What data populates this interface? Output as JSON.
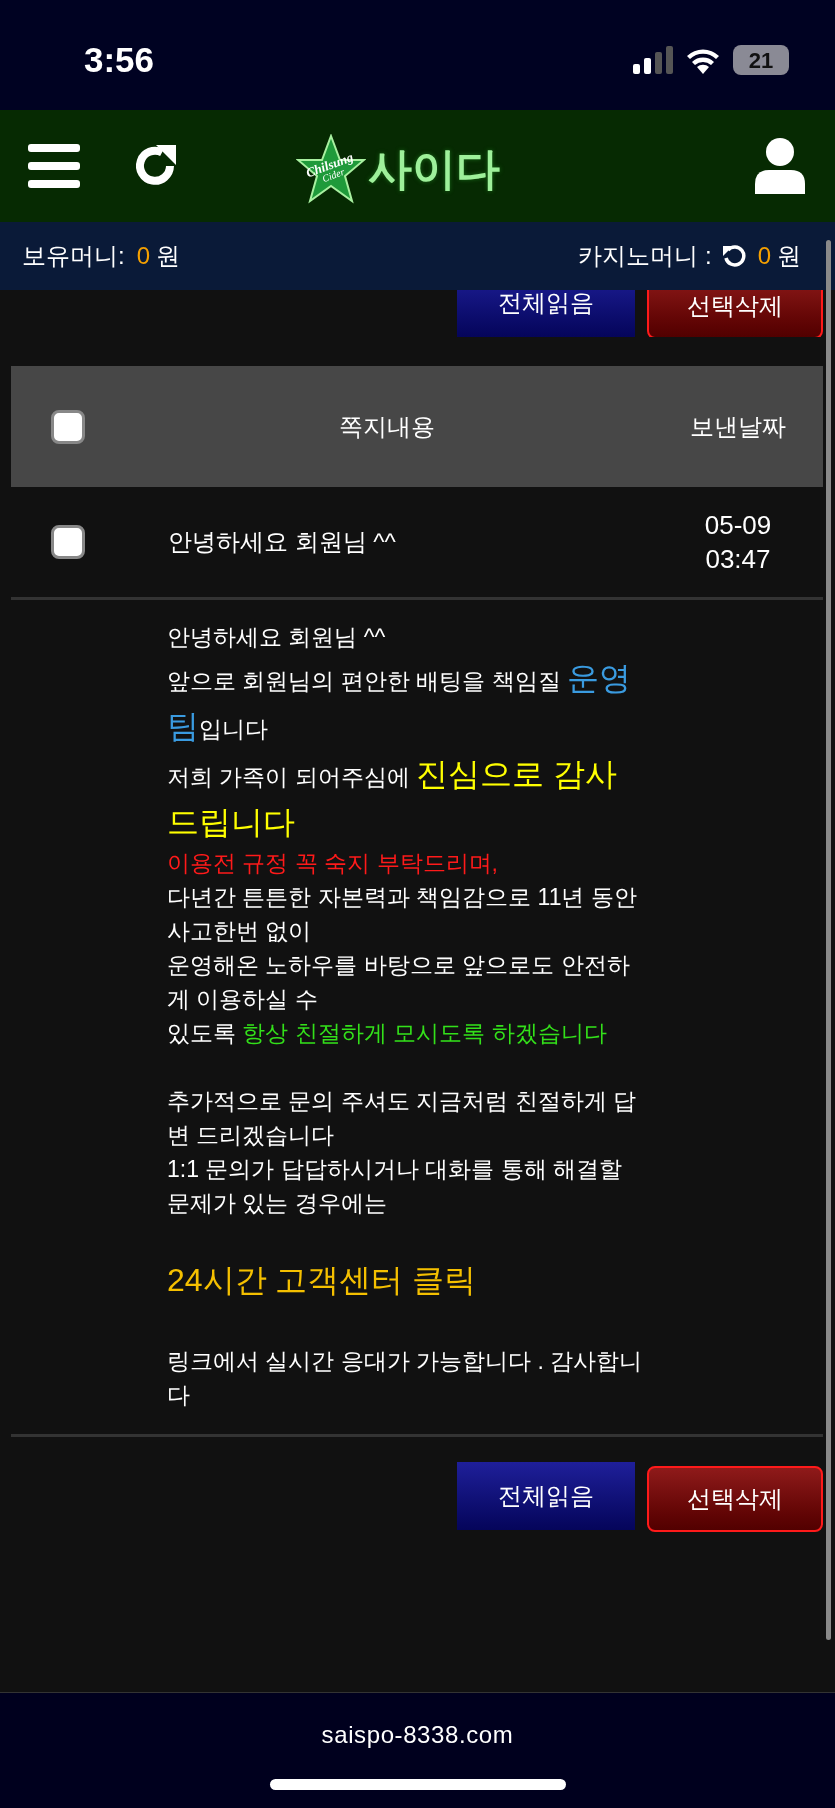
{
  "status_bar": {
    "time": "3:56",
    "battery": "21"
  },
  "header": {
    "logo_badge": [
      "Chilsung",
      "Cider"
    ],
    "logo_title": "사이다"
  },
  "balance_bar": {
    "left_label": "보유머니:",
    "left_amount": "0",
    "left_unit": "원",
    "right_label": "카지노머니 :",
    "right_amount": "0",
    "right_unit": "원"
  },
  "top_buttons": [
    "전체읽음",
    "선택삭제"
  ],
  "table": {
    "select_all": {
      "checked": false
    },
    "columns": [
      "쪽지내용",
      "보낸날짜"
    ],
    "rows": [
      {
        "checked": false,
        "subject": "안녕하세요 회원님 ^^",
        "date": "05-09",
        "time": "03:47"
      }
    ]
  },
  "message": [
    {
      "kind": "text",
      "parts": [
        {
          "text": "안녕하세요 회원님 ^^",
          "color": "#ffffff",
          "large": false
        }
      ]
    },
    {
      "kind": "text",
      "parts": [
        {
          "text": "앞으로 회원님의 편안한 배팅을 책임질 ",
          "color": "#ffffff",
          "large": false
        },
        {
          "text": "운영팀",
          "color": "#3a9be0",
          "large": true
        },
        {
          "text": "입니다",
          "color": "#ffffff",
          "large": false
        }
      ]
    },
    {
      "kind": "text",
      "parts": [
        {
          "text": "저희 가족이 되어주심에 ",
          "color": "#ffffff",
          "large": false
        },
        {
          "text": "진심으로 감사 드립니다",
          "color": "#ffff00",
          "large": true
        }
      ]
    },
    {
      "kind": "text",
      "parts": [
        {
          "text": "이용전 규정 꼭 숙지 부탁드리며,",
          "color": "#ff1a1a",
          "large": false
        }
      ]
    },
    {
      "kind": "text",
      "parts": [
        {
          "text": "다년간 튼튼한 자본력과 책임감으로 11년 동안 사고한번 없이",
          "color": "#ffffff",
          "large": false
        }
      ]
    },
    {
      "kind": "text",
      "parts": [
        {
          "text": "운영해온 노하우를 바탕으로 앞으로도 안전하게 이용하실 수",
          "color": "#ffffff",
          "large": false
        }
      ]
    },
    {
      "kind": "text",
      "parts": [
        {
          "text": "있도록 ",
          "color": "#ffffff",
          "large": false
        },
        {
          "text": "항상 친절하게 모시도록 하겠습니다",
          "color": "#33e01a",
          "large": false
        }
      ]
    },
    {
      "kind": "gap"
    },
    {
      "kind": "text",
      "parts": [
        {
          "text": "추가적으로 문의 주셔도 지금처럼 친절하게 답변 드리겠습니다",
          "color": "#ffffff",
          "large": false
        }
      ]
    },
    {
      "kind": "text",
      "parts": [
        {
          "text": "1:1 문의가 답답하시거나 대화를 통해 해결할 문제가 있는 경우에는",
          "color": "#ffffff",
          "large": false
        }
      ]
    },
    {
      "kind": "gap"
    },
    {
      "kind": "link",
      "parts": [
        {
          "text": "24시간 고객센터  클릭",
          "color": "#f5c000",
          "large": true
        }
      ]
    },
    {
      "kind": "gap"
    },
    {
      "kind": "text",
      "parts": [
        {
          "text": "링크에서 실시간 응대가 가능합니다 . 감사합니다",
          "color": "#ffffff",
          "large": false
        }
      ]
    }
  ],
  "bottom_buttons": [
    "전체읽음",
    "선택삭제"
  ],
  "footer": {
    "url": "saispo-8338.com"
  }
}
